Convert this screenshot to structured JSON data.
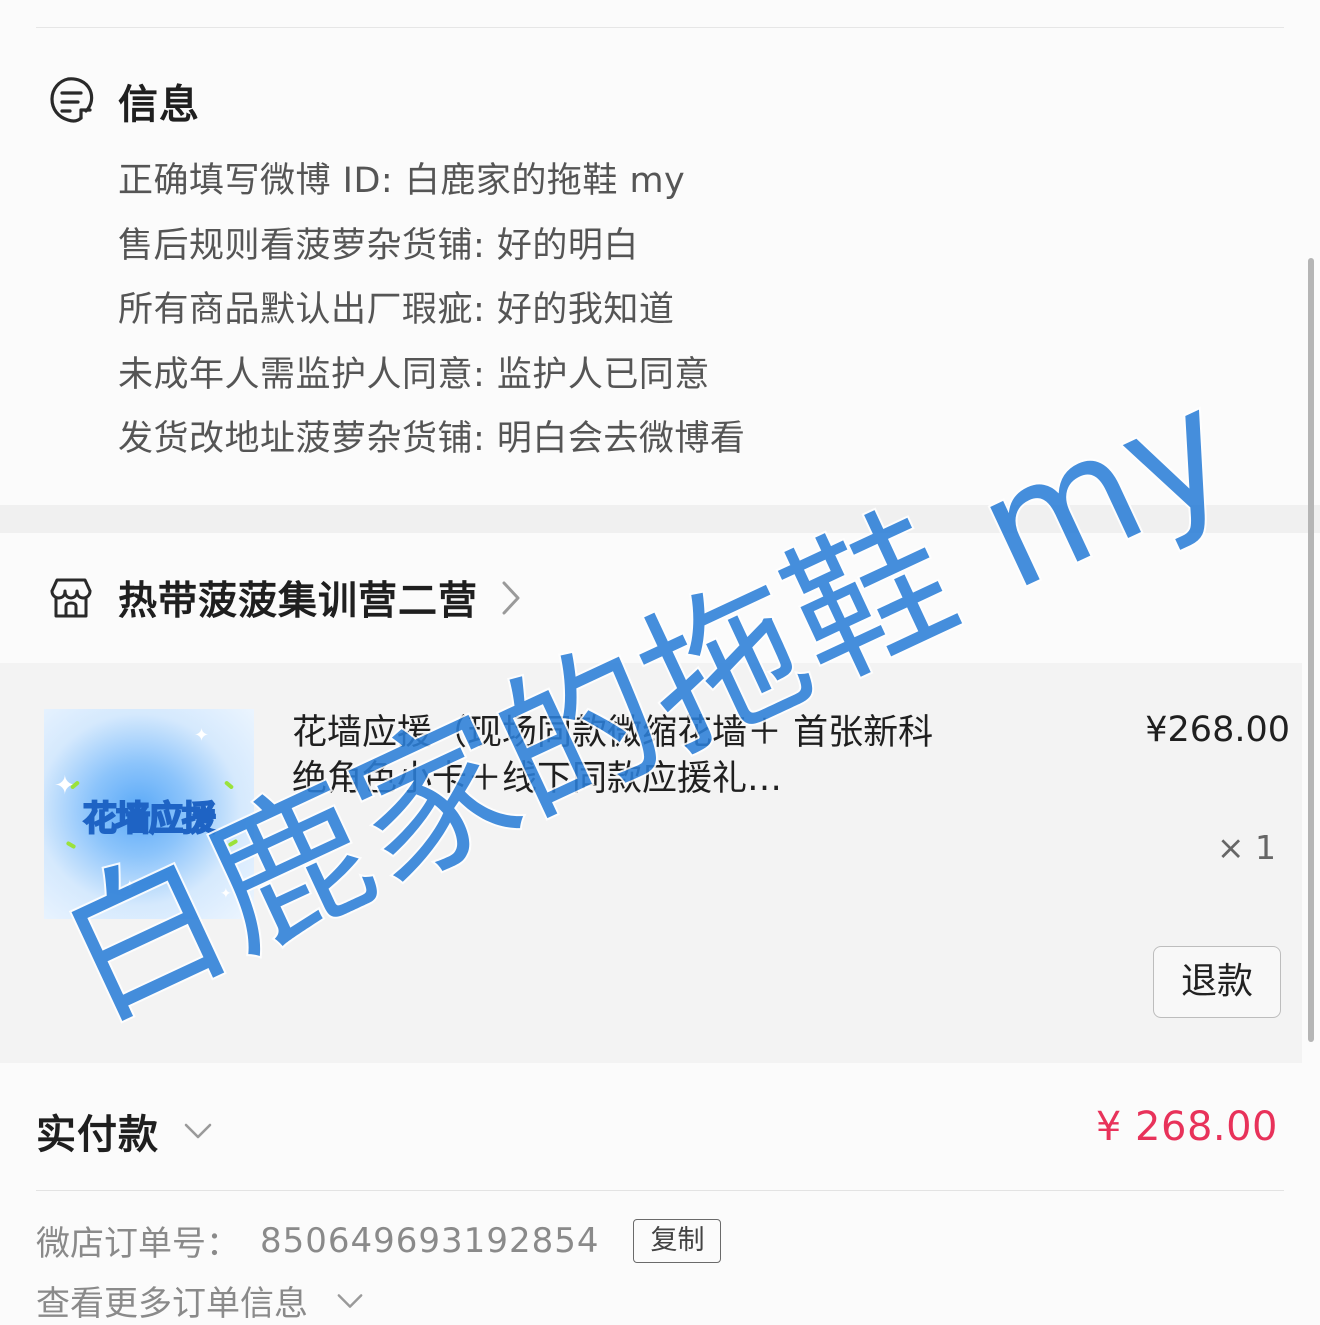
{
  "info": {
    "title": "信息",
    "icon": "note-icon",
    "rows": [
      "正确填写微博 ID: 白鹿家的拖鞋 my",
      "售后规则看菠萝杂货铺: 好的明白",
      "所有商品默认出厂瑕疵: 好的我知道",
      "未成年人需监护人同意: 监护人已同意",
      "发货改地址菠萝杂货铺: 明白会去微博看"
    ]
  },
  "shop": {
    "name": "热带菠菠集训营二营",
    "icon": "store-icon"
  },
  "product": {
    "thumb_text": "花墙应援",
    "title": "花墙应援（现场同款微缩花墙＋      首张新科绝角色小卡＋线下同款应援礼…",
    "price": "¥268.00",
    "qty": "× 1",
    "refund_label": "退款"
  },
  "payment": {
    "label": "实付款",
    "amount": "¥ 268.00",
    "accent_color": "#e8325a"
  },
  "order": {
    "label": "微店订单号：",
    "number": "850649693192854",
    "copy_label": "复制",
    "more_label": "查看更多订单信息"
  },
  "watermark": "白鹿家的拖鞋 my"
}
